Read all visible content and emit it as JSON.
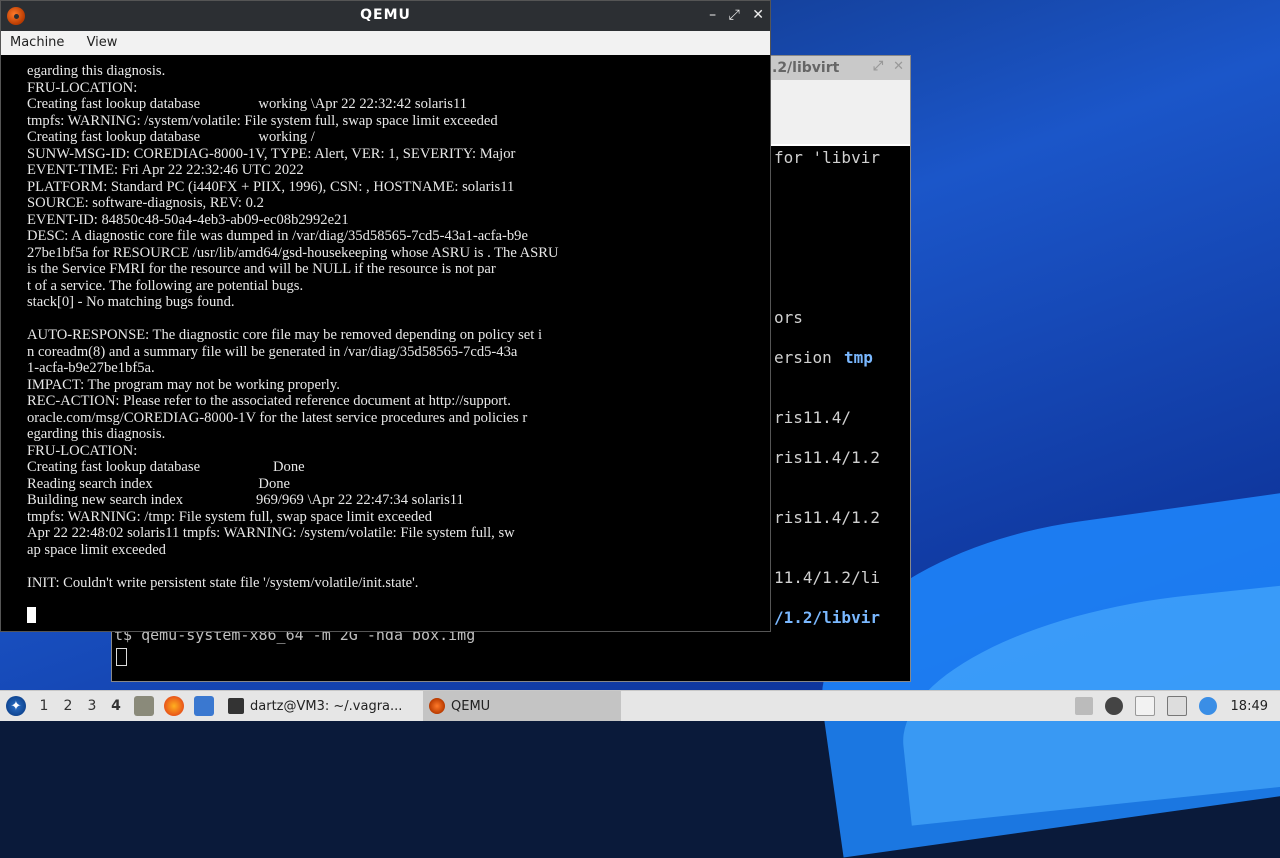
{
  "qemu_window": {
    "title": "QEMU",
    "controls": {
      "minimize": "–",
      "maximize": "⤢",
      "close": "✕"
    },
    "menu": [
      "Machine",
      "View"
    ],
    "console_lines": [
      "egarding this diagnosis.",
      "FRU-LOCATION:",
      "Creating fast lookup database                working \\Apr 22 22:32:42 solaris11",
      "tmpfs: WARNING: /system/volatile: File system full, swap space limit exceeded",
      "Creating fast lookup database                working /",
      "SUNW-MSG-ID: COREDIAG-8000-1V, TYPE: Alert, VER: 1, SEVERITY: Major",
      "EVENT-TIME: Fri Apr 22 22:32:46 UTC 2022",
      "PLATFORM: Standard PC (i440FX + PIIX, 1996), CSN: , HOSTNAME: solaris11",
      "SOURCE: software-diagnosis, REV: 0.2",
      "EVENT-ID: 84850c48-50a4-4eb3-ab09-ec08b2992e21",
      "DESC: A diagnostic core file was dumped in /var/diag/35d58565-7cd5-43a1-acfa-b9e",
      "27be1bf5a for RESOURCE /usr/lib/amd64/gsd-housekeeping whose ASRU is . The ASRU",
      "is the Service FMRI for the resource and will be NULL if the resource is not par",
      "t of a service. The following are potential bugs.",
      "stack[0] - No matching bugs found.",
      "",
      "AUTO-RESPONSE: The diagnostic core file may be removed depending on policy set i",
      "n coreadm(8) and a summary file will be generated in /var/diag/35d58565-7cd5-43a",
      "1-acfa-b9e27be1bf5a.",
      "IMPACT: The program may not be working properly.",
      "REC-ACTION: Please refer to the associated reference document at http://support.",
      "oracle.com/msg/COREDIAG-8000-1V for the latest service procedures and policies r",
      "egarding this diagnosis.",
      "FRU-LOCATION:",
      "Creating fast lookup database                    Done",
      "Reading search index                             Done",
      "Building new search index                    969/969 \\Apr 22 22:47:34 solaris11",
      "tmpfs: WARNING: /tmp: File system full, swap space limit exceeded",
      "Apr 22 22:48:02 solaris11 tmpfs: WARNING: /system/volatile: File system full, sw",
      "ap space limit exceeded",
      "",
      "INIT: Couldn't write persistent state file '/system/volatile/init.state'."
    ]
  },
  "background_terminal": {
    "title_fragment": ".2/libvirt",
    "visible_fragments": [
      {
        "text": "for 'libvir",
        "accent": false
      },
      {
        "text": "ors",
        "accent": false
      },
      {
        "text": "ersion",
        "accent": false
      },
      {
        "text": "ris11.4/",
        "accent": false
      },
      {
        "text": "ris11.4/1.2",
        "accent": false
      },
      {
        "text": "ris11.4/1.2",
        "accent": false
      },
      {
        "text": "11.4/1.2/li",
        "accent": false
      },
      {
        "text": "/1.2/libvir",
        "accent": true
      }
    ],
    "tmp_label": "tmp",
    "prompt": "t$ qemu-system-x86_64 -m 2G -hda box.img"
  },
  "taskbar": {
    "workspaces": [
      "1",
      "2",
      "3",
      "4"
    ],
    "active_workspace": "4",
    "tasks": [
      {
        "label": "dartz@VM3: ~/.vagra..."
      },
      {
        "label": "QEMU"
      }
    ],
    "clock": "18:49"
  }
}
